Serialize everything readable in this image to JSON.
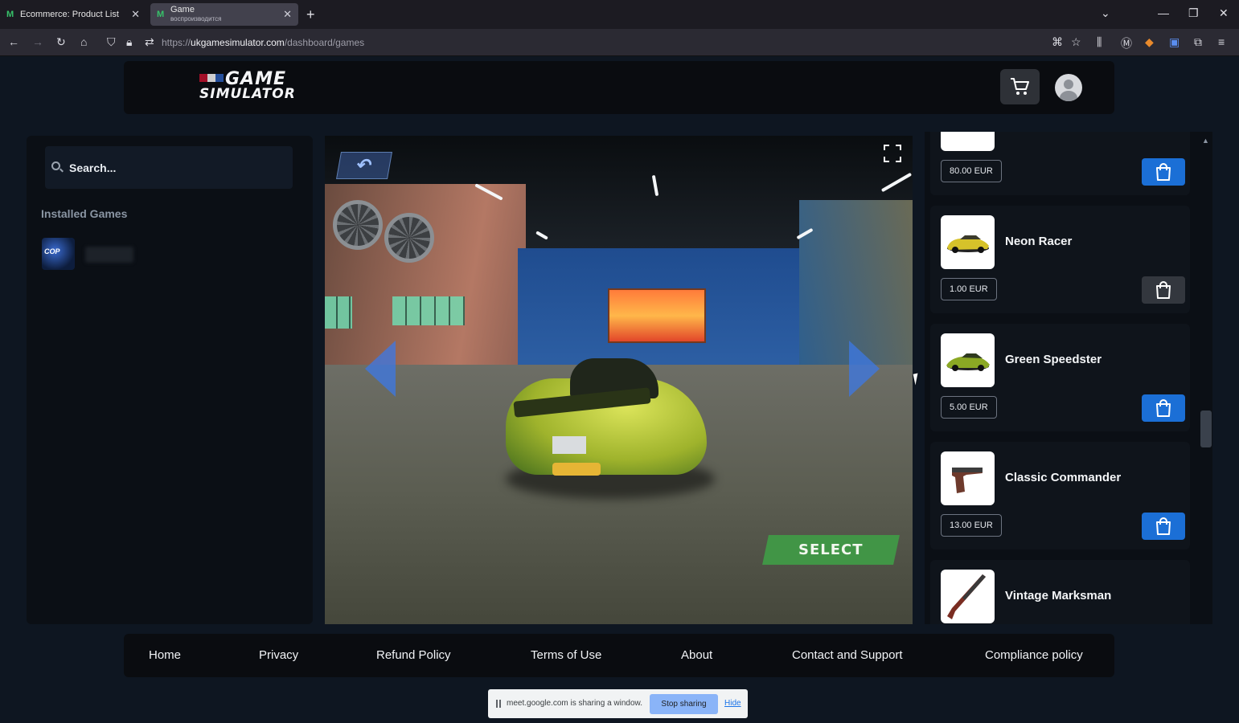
{
  "browser": {
    "tabs": [
      {
        "title": "Ecommerce: Product List",
        "subtitle": ""
      },
      {
        "title": "Game",
        "subtitle": "воспроизводится"
      }
    ],
    "url_prefix": "https://",
    "url_host": "ukgamesimulator.com",
    "url_path": "/dashboard/games"
  },
  "header": {
    "logo_line1": "GAME",
    "logo_line2": "SIMULATOR"
  },
  "sidebar": {
    "search_placeholder": "Search...",
    "installed_title": "Installed Games",
    "installed": [
      {
        "thumb_text": "COP"
      }
    ]
  },
  "game": {
    "select_label": "SELECT",
    "back_icon": "undo-arrow-icon",
    "fullscreen_icon": "fullscreen-icon"
  },
  "products": [
    {
      "name": "",
      "price": "80.00 EUR",
      "buy_active": true
    },
    {
      "name": "Neon Racer",
      "price": "1.00 EUR",
      "buy_active": false
    },
    {
      "name": "Green Speedster",
      "price": "5.00 EUR",
      "buy_active": true
    },
    {
      "name": "Classic Commander",
      "price": "13.00 EUR",
      "buy_active": true
    },
    {
      "name": "Vintage Marksman",
      "price": "",
      "buy_active": true
    }
  ],
  "footer": {
    "links": [
      "Home",
      "Privacy",
      "Refund Policy",
      "Terms of Use",
      "About",
      "Contact and Support",
      "Compliance policy"
    ]
  },
  "meet_banner": {
    "message": "meet.google.com is sharing a window.",
    "stop_label": "Stop sharing",
    "hide_label": "Hide"
  },
  "colors": {
    "accent": "#1b6fd6",
    "page_bg": "#0e1621",
    "select_green": "#3f9c46"
  }
}
